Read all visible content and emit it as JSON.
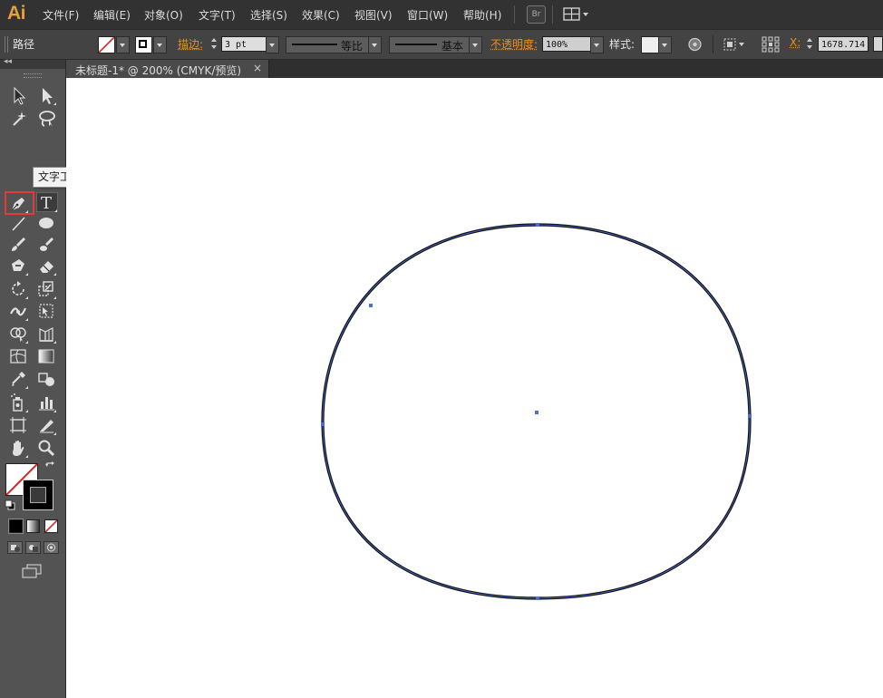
{
  "app": {
    "logo": "Ai"
  },
  "menu": [
    "文件(F)",
    "编辑(E)",
    "对象(O)",
    "文字(T)",
    "选择(S)",
    "效果(C)",
    "视图(V)",
    "窗口(W)",
    "帮助(H)"
  ],
  "toolbar_badge": "Br",
  "control": {
    "object_type": "路径",
    "stroke_label": "描边:",
    "stroke_weight": "3 pt",
    "profile_label": "等比",
    "brush_label": "基本",
    "opacity_label": "不透明度:",
    "opacity_value": "100%",
    "style_label": "样式:",
    "x_label": "X:",
    "x_value": "1678.714"
  },
  "document": {
    "tab_title": "未标题-1* @ 200% (CMYK/预览)",
    "close_glyph": "×"
  },
  "tooltip": "文字工具 (T)",
  "colors": {
    "accent": "#e8921c",
    "selection": "#4a6fd8",
    "highlight": "#e23a3a",
    "canvas": "#ffffff"
  },
  "icons": [
    "selection-icon",
    "direct-selection-icon",
    "magic-wand-icon",
    "lasso-icon",
    "pen-icon",
    "type-icon",
    "line-icon",
    "ellipse-icon",
    "paintbrush-icon",
    "blob-brush-icon",
    "shaper-icon",
    "eraser-icon",
    "rotate-icon",
    "scale-icon",
    "width-icon",
    "free-transform-icon",
    "shape-builder-icon",
    "perspective-grid-icon",
    "mesh-icon",
    "gradient-icon",
    "eyedropper-icon",
    "blend-icon",
    "symbol-sprayer-icon",
    "column-graph-icon",
    "artboard-icon",
    "slice-icon",
    "hand-icon",
    "zoom-icon"
  ]
}
